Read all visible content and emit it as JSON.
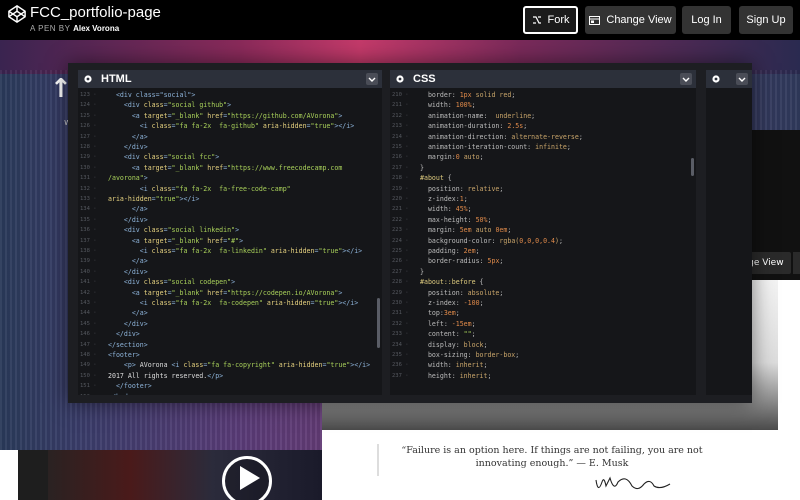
{
  "header": {
    "title": "FCC_portfolio-page",
    "by_label": "A PEN BY",
    "author": "Alex Vorona",
    "fork_label": "Fork",
    "change_view_label": "Change View",
    "login_label": "Log In",
    "signup_label": "Sign Up"
  },
  "preview": {
    "hero_text": "↑A",
    "hero_sub": "w",
    "right_button": "nge View",
    "quote": "“Failure is an option here. If things are not failing, you are not innovating enough.” — E. Musk"
  },
  "editor": {
    "html_label": "HTML",
    "css_label": "CSS",
    "html_start_line": 123,
    "css_start_line": 210,
    "html_lines": [
      [
        [
          "t-tag",
          "  <div class=\"social\">"
        ]
      ],
      [
        [
          "t-tag",
          "    <div "
        ],
        [
          "t-attr",
          "class"
        ],
        [
          "t-tag",
          "="
        ],
        [
          "t-str",
          "\"social github\""
        ],
        [
          "t-tag",
          ">"
        ]
      ],
      [
        [
          "t-tag",
          "      <a "
        ],
        [
          "t-attr",
          "target"
        ],
        [
          "t-tag",
          "="
        ],
        [
          "t-str",
          "\"_blank\""
        ],
        [
          "t-tag",
          " "
        ],
        [
          "t-attr",
          "href"
        ],
        [
          "t-tag",
          "="
        ],
        [
          "t-str",
          "\"https://github.com/AVorona\""
        ],
        [
          "t-tag",
          ">"
        ]
      ],
      [
        [
          "t-tag",
          "        <i "
        ],
        [
          "t-attr",
          "class"
        ],
        [
          "t-tag",
          "="
        ],
        [
          "t-str",
          "\"fa fa-2x  fa-github\""
        ],
        [
          "t-tag",
          " "
        ],
        [
          "t-attr",
          "aria-hidden"
        ],
        [
          "t-tag",
          "="
        ],
        [
          "t-str",
          "\"true\""
        ],
        [
          "t-tag",
          "></i>"
        ]
      ],
      [
        [
          "t-tag",
          "      </a>"
        ]
      ],
      [
        [
          "t-tag",
          "    </div>"
        ]
      ],
      [
        [
          "t-tag",
          "    <div "
        ],
        [
          "t-attr",
          "class"
        ],
        [
          "t-tag",
          "="
        ],
        [
          "t-str",
          "\"social fcc\""
        ],
        [
          "t-tag",
          ">"
        ]
      ],
      [
        [
          "t-tag",
          "      <a "
        ],
        [
          "t-attr",
          "target"
        ],
        [
          "t-tag",
          "="
        ],
        [
          "t-str",
          "\"_blank\""
        ],
        [
          "t-tag",
          " "
        ],
        [
          "t-attr",
          "href"
        ],
        [
          "t-tag",
          "="
        ],
        [
          "t-str",
          "\"https://www.freecodecamp.com"
        ]
      ],
      [
        [
          "t-str",
          "/avorona\""
        ],
        [
          "t-tag",
          ">"
        ]
      ],
      [
        [
          "t-tag",
          "        <i "
        ],
        [
          "t-attr",
          "class"
        ],
        [
          "t-tag",
          "="
        ],
        [
          "t-str",
          "\"fa fa-2x  fa-free-code-camp\""
        ]
      ],
      [
        [
          "t-attr",
          "aria-hidden"
        ],
        [
          "t-tag",
          "="
        ],
        [
          "t-str",
          "\"true\""
        ],
        [
          "t-tag",
          "></i>"
        ]
      ],
      [
        [
          "t-tag",
          "      </a>"
        ]
      ],
      [
        [
          "t-tag",
          "    </div>"
        ]
      ],
      [
        [
          "t-tag",
          "    <div "
        ],
        [
          "t-attr",
          "class"
        ],
        [
          "t-tag",
          "="
        ],
        [
          "t-str",
          "\"social linkedin\""
        ],
        [
          "t-tag",
          ">"
        ]
      ],
      [
        [
          "t-tag",
          "      <a "
        ],
        [
          "t-attr",
          "target"
        ],
        [
          "t-tag",
          "="
        ],
        [
          "t-str",
          "\"_blank\""
        ],
        [
          "t-tag",
          " "
        ],
        [
          "t-attr",
          "href"
        ],
        [
          "t-tag",
          "="
        ],
        [
          "t-str",
          "\"#\""
        ],
        [
          "t-tag",
          ">"
        ]
      ],
      [
        [
          "t-tag",
          "        <i "
        ],
        [
          "t-attr",
          "class"
        ],
        [
          "t-tag",
          "="
        ],
        [
          "t-str",
          "\"fa fa-2x  fa-linkedin\""
        ],
        [
          "t-tag",
          " "
        ],
        [
          "t-attr",
          "aria-hidden"
        ],
        [
          "t-tag",
          "="
        ],
        [
          "t-str",
          "\"true\""
        ],
        [
          "t-tag",
          "></i>"
        ]
      ],
      [
        [
          "t-tag",
          "      </a>"
        ]
      ],
      [
        [
          "t-tag",
          "    </div>"
        ]
      ],
      [
        [
          "t-tag",
          "    <div "
        ],
        [
          "t-attr",
          "class"
        ],
        [
          "t-tag",
          "="
        ],
        [
          "t-str",
          "\"social codepen\""
        ],
        [
          "t-tag",
          ">"
        ]
      ],
      [
        [
          "t-tag",
          "      <a "
        ],
        [
          "t-attr",
          "target"
        ],
        [
          "t-tag",
          "="
        ],
        [
          "t-str",
          "\"_blank\""
        ],
        [
          "t-tag",
          " "
        ],
        [
          "t-attr",
          "href"
        ],
        [
          "t-tag",
          "="
        ],
        [
          "t-str",
          "\"https://codepen.io/AVorona\""
        ],
        [
          "t-tag",
          ">"
        ]
      ],
      [
        [
          "t-tag",
          "        <i "
        ],
        [
          "t-attr",
          "class"
        ],
        [
          "t-tag",
          "="
        ],
        [
          "t-str",
          "\"fa fa-2x  fa-codepen\""
        ],
        [
          "t-tag",
          " "
        ],
        [
          "t-attr",
          "aria-hidden"
        ],
        [
          "t-tag",
          "="
        ],
        [
          "t-str",
          "\"true\""
        ],
        [
          "t-tag",
          "></i>"
        ]
      ],
      [
        [
          "t-tag",
          "      </a>"
        ]
      ],
      [
        [
          "t-tag",
          "    </div>"
        ]
      ],
      [
        [
          "t-tag",
          "  </div>"
        ]
      ],
      [
        [
          "t-tag",
          "</section>"
        ]
      ],
      [
        [
          "t-tag",
          "<footer>"
        ]
      ],
      [
        [
          "t-tag",
          "    <p> "
        ],
        [
          "t-txt",
          "AVorona "
        ],
        [
          "t-tag",
          "<i "
        ],
        [
          "t-attr",
          "class"
        ],
        [
          "t-tag",
          "="
        ],
        [
          "t-str",
          "\"fa fa-copyright\""
        ],
        [
          "t-tag",
          " "
        ],
        [
          "t-attr",
          "aria-hidden"
        ],
        [
          "t-tag",
          "="
        ],
        [
          "t-str",
          "\"true\""
        ],
        [
          "t-tag",
          "></i>"
        ]
      ],
      [
        [
          "t-txt",
          "2017 All rights reserved."
        ],
        [
          "t-tag",
          "</p>"
        ]
      ],
      [
        [
          "t-tag",
          "  </footer>"
        ]
      ],
      [
        [
          "t-tag",
          "</body>"
        ]
      ]
    ],
    "css_lines": [
      [
        [
          "t-prop",
          "  border: "
        ],
        [
          "t-num",
          "1px"
        ],
        [
          "t-val",
          " solid red"
        ],
        [
          "t-prop",
          ";"
        ]
      ],
      [
        [
          "t-prop",
          "  width: "
        ],
        [
          "t-num",
          "100%"
        ],
        [
          "t-prop",
          ";"
        ]
      ],
      [
        [
          "t-prop",
          "  animation-name: "
        ],
        [
          "t-val",
          " underline"
        ],
        [
          "t-prop",
          ";"
        ]
      ],
      [
        [
          "t-prop",
          "  animation-duration: "
        ],
        [
          "t-num",
          "2.5s"
        ],
        [
          "t-prop",
          ";"
        ]
      ],
      [
        [
          "t-prop",
          "  animation-direction: "
        ],
        [
          "t-val",
          "alternate-reverse"
        ],
        [
          "t-prop",
          ";"
        ]
      ],
      [
        [
          "t-prop",
          "  animation-iteration-count: "
        ],
        [
          "t-val",
          "infinite"
        ],
        [
          "t-prop",
          ";"
        ]
      ],
      [
        [
          "t-prop",
          "  margin:"
        ],
        [
          "t-num",
          "0"
        ],
        [
          "t-val",
          " auto"
        ],
        [
          "t-prop",
          ";"
        ]
      ],
      [
        [
          "t-prop",
          "}"
        ]
      ],
      [
        [
          "t-sel",
          "#about"
        ],
        [
          "t-prop",
          " {"
        ]
      ],
      [
        [
          "t-prop",
          "  position: "
        ],
        [
          "t-val",
          "relative"
        ],
        [
          "t-prop",
          ";"
        ]
      ],
      [
        [
          "t-prop",
          "  z-index:"
        ],
        [
          "t-num",
          "1"
        ],
        [
          "t-prop",
          ";"
        ]
      ],
      [
        [
          "t-prop",
          "  width: "
        ],
        [
          "t-num",
          "45%"
        ],
        [
          "t-prop",
          ";"
        ]
      ],
      [
        [
          "t-prop",
          "  max-height: "
        ],
        [
          "t-num",
          "50%"
        ],
        [
          "t-prop",
          ";"
        ]
      ],
      [
        [
          "t-prop",
          "  margin: "
        ],
        [
          "t-num",
          "5em"
        ],
        [
          "t-val",
          " auto "
        ],
        [
          "t-num",
          "0em"
        ],
        [
          "t-prop",
          ";"
        ]
      ],
      [
        [
          "t-prop",
          "  background-color: "
        ],
        [
          "t-val",
          "rgba("
        ],
        [
          "t-num",
          "0,0,0,0.4"
        ],
        [
          "t-val",
          ")"
        ],
        [
          "t-prop",
          ";"
        ]
      ],
      [
        [
          "t-prop",
          "  padding: "
        ],
        [
          "t-num",
          "2em"
        ],
        [
          "t-prop",
          ";"
        ]
      ],
      [
        [
          "t-prop",
          "  border-radius: "
        ],
        [
          "t-num",
          "5px"
        ],
        [
          "t-prop",
          ";"
        ]
      ],
      [
        [
          "t-prop",
          "}"
        ]
      ],
      [
        [
          "t-sel",
          "#about::before"
        ],
        [
          "t-prop",
          " {"
        ]
      ],
      [
        [
          "t-prop",
          "  position: "
        ],
        [
          "t-val",
          "absolute"
        ],
        [
          "t-prop",
          ";"
        ]
      ],
      [
        [
          "t-prop",
          "  z-index: "
        ],
        [
          "t-num",
          "-100"
        ],
        [
          "t-prop",
          ";"
        ]
      ],
      [
        [
          "t-prop",
          "  top:"
        ],
        [
          "t-num",
          "3em"
        ],
        [
          "t-prop",
          ";"
        ]
      ],
      [
        [
          "t-prop",
          "  left: "
        ],
        [
          "t-num",
          "-15em"
        ],
        [
          "t-prop",
          ";"
        ]
      ],
      [
        [
          "t-prop",
          "  content: "
        ],
        [
          "t-str",
          "\"\""
        ],
        [
          "t-prop",
          ";"
        ]
      ],
      [
        [
          "t-prop",
          "  display: "
        ],
        [
          "t-val",
          "block"
        ],
        [
          "t-prop",
          ";"
        ]
      ],
      [
        [
          "t-prop",
          "  box-sizing: "
        ],
        [
          "t-val",
          "border-box"
        ],
        [
          "t-prop",
          ";"
        ]
      ],
      [
        [
          "t-prop",
          "  width: "
        ],
        [
          "t-val",
          "inherit"
        ],
        [
          "t-prop",
          ";"
        ]
      ],
      [
        [
          "t-prop",
          "  height: "
        ],
        [
          "t-val",
          "inherit"
        ],
        [
          "t-prop",
          ";"
        ]
      ]
    ]
  },
  "colors": {
    "topbar": "#000000",
    "editor_bg": "#1d1e22",
    "pane_header": "#2c303a",
    "code_bg": "#151619"
  }
}
